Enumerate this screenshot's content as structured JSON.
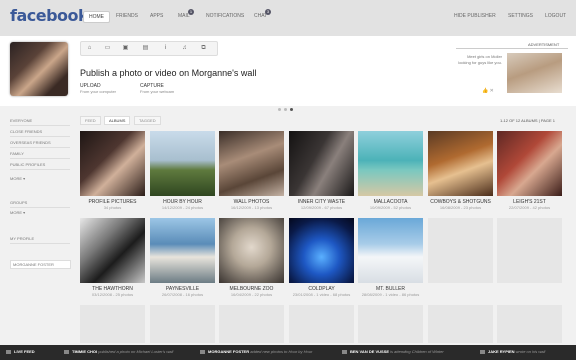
{
  "header": {
    "logo": "facebook",
    "nav": [
      {
        "label": "HOME",
        "active": true
      },
      {
        "label": "FRIENDS"
      },
      {
        "label": "APPS"
      },
      {
        "label": "MAIL",
        "badge": "1"
      },
      {
        "label": "NOTIFICATIONS"
      },
      {
        "label": "CHAT",
        "badge": "3"
      }
    ],
    "right_nav": [
      "HIDE PUBLISHER",
      "SETTINGS",
      "LOGOUT"
    ]
  },
  "publisher": {
    "prompt": "Publish a photo or video on Morganne's wall",
    "actions": [
      {
        "label": "UPLOAD",
        "sub": "From your computer"
      },
      {
        "label": "CAPTURE",
        "sub": "From your webcam"
      }
    ],
    "tool_icons": [
      "home-icon",
      "wall-icon",
      "photo-icon",
      "video-icon",
      "info-icon",
      "music-icon",
      "links-icon"
    ]
  },
  "ad": {
    "title": "ADVERTISMENT",
    "text": "Meet girls on Moller looking for guys like you."
  },
  "sidebar": {
    "filters": [
      "EVERYONE",
      "CLOSE FRIENDS",
      "OVERSEAS FRIENDS",
      "FAMILY",
      "PUBLIC PROFILES",
      "MORE ▾"
    ],
    "groups_label": "GROUPS",
    "groups_more": "MORE ▾",
    "my_profile": "MY PROFILE",
    "user": "MORGANNE FOSTER"
  },
  "tabs": [
    "FEED",
    "ALBUMS",
    "TAGGED"
  ],
  "albums_count": "1-12 OF 12 ALBUMS | PAGE 1",
  "albums": [
    {
      "title": "PROFILE PICTURES",
      "meta": "34 photos"
    },
    {
      "title": "HOUR BY HOUR",
      "meta": "14/12/2009 - 24 photos"
    },
    {
      "title": "WALL PHOTOS",
      "meta": "16/12/2009 - 13 photos"
    },
    {
      "title": "INNER CITY WASTE",
      "meta": "12/09/2009 - 67 photos"
    },
    {
      "title": "MALLACOOTA",
      "meta": "10/09/2009 - 52 photos"
    },
    {
      "title": "COWBOYS & SHOTGUNS",
      "meta": "16/08/2009 - 23 photos"
    },
    {
      "title": "LEIGH'S 21ST",
      "meta": "22/07/2009 - 42 photos"
    },
    {
      "title": "THE HAWTHORN",
      "meta": "03/12/2008 - 25 photos"
    },
    {
      "title": "PAYNESVILLE",
      "meta": "26/07/2008 - 16 photos"
    },
    {
      "title": "MELBOURNE ZOO",
      "meta": "16/04/2009 - 22 photos"
    },
    {
      "title": "COLDPLAY",
      "meta": "23/01/2008 - 1 video - 68 photos"
    },
    {
      "title": "MT. BULLER",
      "meta": "28/08/2009 - 1 video - 86 photos"
    }
  ],
  "live_feed": {
    "label": "LIVE FEED",
    "items": [
      {
        "name": "TIMMIE CHOI",
        "text": "published a photo on Michael Luster's wall"
      },
      {
        "name": "MORGANNE FOSTER",
        "text": "added new photos to Hour by Hour"
      },
      {
        "name": "BEN VAN DE VUSSE",
        "text": "is attending Children of Winter"
      },
      {
        "name": "JAKE RYPIEN",
        "text": "wrote on his wall"
      }
    ]
  }
}
